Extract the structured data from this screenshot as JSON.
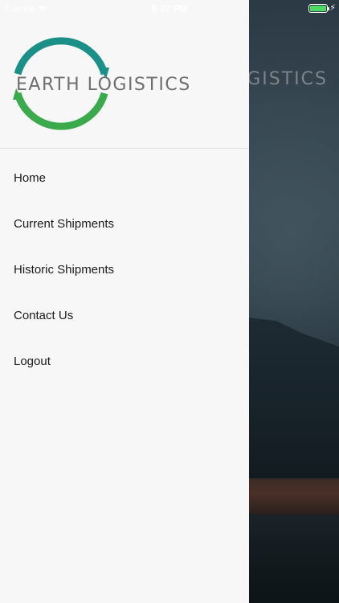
{
  "status_bar": {
    "carrier": "Carrier",
    "time": "6:07 PM",
    "battery_percent": 100,
    "charging": true
  },
  "drawer": {
    "logo_text": "EARTH LOGISTICS",
    "menu": [
      {
        "label": "Home"
      },
      {
        "label": "Current Shipments"
      },
      {
        "label": "Historic Shipments"
      },
      {
        "label": "Contact Us"
      },
      {
        "label": "Logout"
      }
    ]
  },
  "background": {
    "logo_text_partial": "GISTICS"
  },
  "colors": {
    "ring_top": "#1a9088",
    "ring_bottom": "#3aaa4c",
    "logo_text": "#6e6e6e",
    "drawer_bg": "#f7f7f7",
    "battery": "#4cd964"
  }
}
